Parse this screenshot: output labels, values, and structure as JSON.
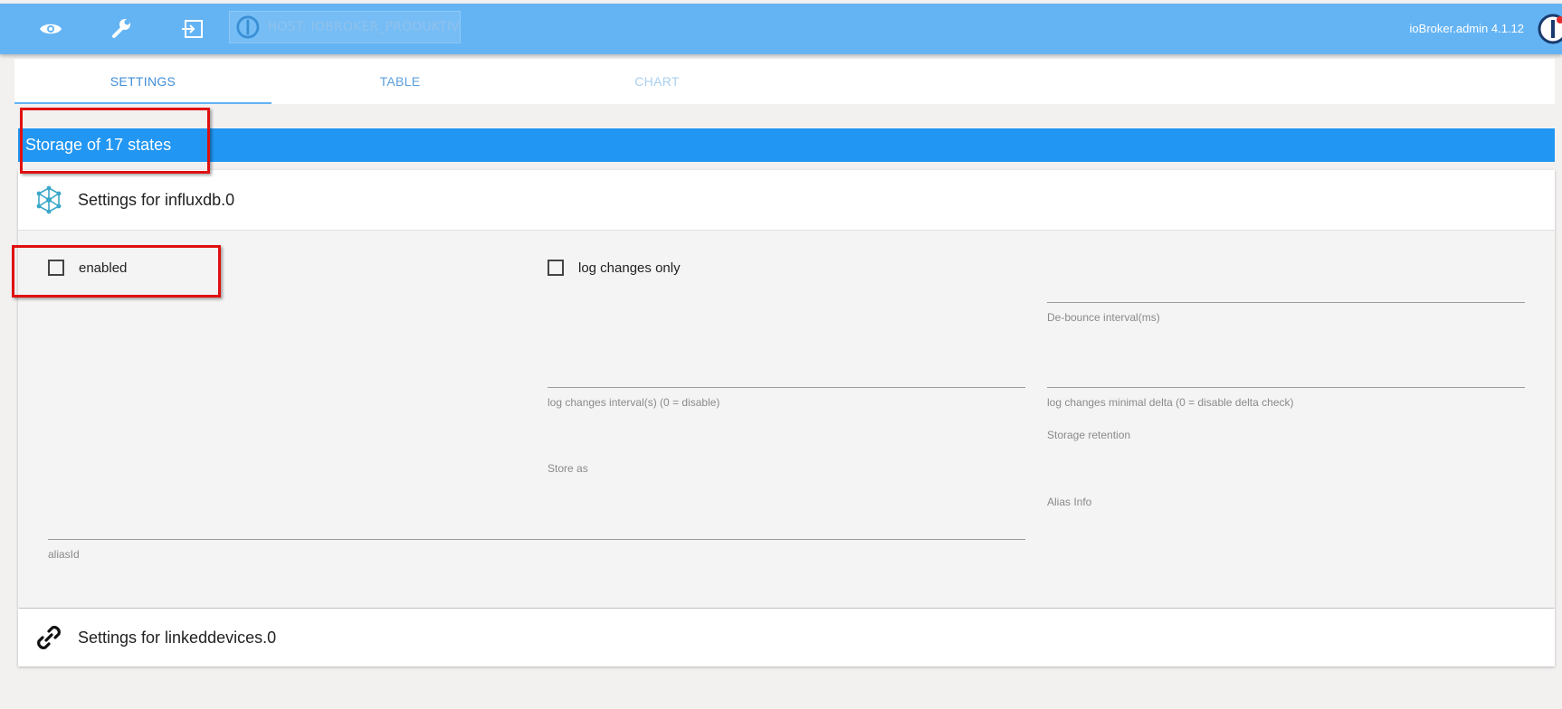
{
  "topbar": {
    "host_label": "HOST: IOBROKER_PRODUKTIV",
    "version": "ioBroker.admin 4.1.12",
    "icons": [
      "eye-icon",
      "wrench-icon",
      "logout-icon"
    ]
  },
  "tabs": [
    {
      "label": "SETTINGS",
      "state": "active"
    },
    {
      "label": "TABLE",
      "state": "inactive"
    },
    {
      "label": "CHART",
      "state": "disabled"
    }
  ],
  "storage_header": "Storage of 17 states",
  "influx_panel": {
    "title": "Settings for influxdb.0",
    "enabled_label": "enabled",
    "log_changes_only_label": "log changes only",
    "debounce_label": "De-bounce interval(ms)",
    "log_changes_interval_label": "log changes interval(s) (0 = disable)",
    "log_changes_delta_label": "log changes minimal delta (0 = disable delta check)",
    "storage_retention_label": "Storage retention",
    "store_as_label": "Store as",
    "alias_info_label": "Alias Info",
    "alias_id_label": "aliasId"
  },
  "linked_panel": {
    "title": "Settings for linkeddevices.0"
  },
  "colors": {
    "topbar": "#64b4f4",
    "header": "#2196f3",
    "annotation": "#e01010"
  }
}
